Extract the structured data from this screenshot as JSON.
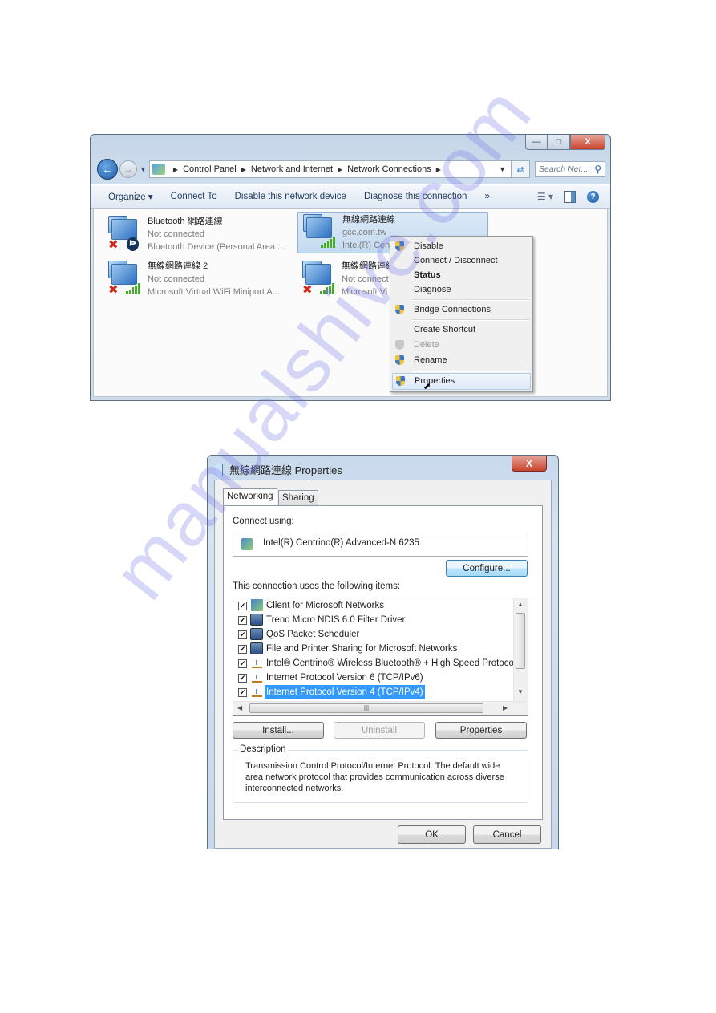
{
  "explorer": {
    "window_buttons": {
      "minimize": "—",
      "maximize": "□",
      "close": "X"
    },
    "breadcrumb": [
      "Control Panel",
      "Network and Internet",
      "Network Connections"
    ],
    "search_placeholder": "Search Net...",
    "toolbar": {
      "organize": "Organize ▾",
      "connect_to": "Connect To",
      "disable_device": "Disable this network device",
      "diagnose": "Diagnose this connection",
      "more": "»"
    },
    "connections": [
      {
        "name": "Bluetooth 網路連線",
        "status": "Not connected",
        "device": "Bluetooth Device (Personal Area ...",
        "icon": "bluetooth-disconnected",
        "selected": false
      },
      {
        "name": "無線網路連線",
        "status": "gcc.com.tw",
        "device": "Intel(R) Cent",
        "icon": "wireless-connected",
        "selected": true
      },
      {
        "name": "無線網路連線 2",
        "status": "Not connected",
        "device": "Microsoft Virtual WiFi Miniport A...",
        "icon": "wireless-disconnected",
        "selected": false
      },
      {
        "name": "無線網路連線",
        "status": "Not connect",
        "device": "Microsoft Vi",
        "icon": "wireless-disconnected",
        "selected": false
      }
    ],
    "context_menu": [
      {
        "label": "Disable",
        "shield": true
      },
      {
        "label": "Connect / Disconnect",
        "shield": false
      },
      {
        "label": "Status",
        "shield": false,
        "bold": true
      },
      {
        "label": "Diagnose",
        "shield": false
      },
      {
        "label": "Bridge Connections",
        "shield": true
      },
      {
        "label": "Create Shortcut",
        "shield": false
      },
      {
        "label": "Delete",
        "shield": true,
        "disabled": true
      },
      {
        "label": "Rename",
        "shield": true
      },
      {
        "label": "Properties",
        "shield": true,
        "hovered": true
      }
    ]
  },
  "dialog": {
    "title": "無線網路連線 Properties",
    "close": "X",
    "tabs": [
      "Networking",
      "Sharing"
    ],
    "active_tab": "Networking",
    "connect_using_label": "Connect using:",
    "adapter": "Intel(R) Centrino(R) Advanced-N 6235",
    "configure_button": "Configure...",
    "items_label": "This connection uses the following items:",
    "items": [
      {
        "label": "Client for Microsoft Networks",
        "checked": true,
        "icon": "network-client"
      },
      {
        "label": "Trend Micro NDIS 6.0 Filter Driver",
        "checked": true,
        "icon": "computer-service"
      },
      {
        "label": "QoS Packet Scheduler",
        "checked": true,
        "icon": "computer-service"
      },
      {
        "label": "File and Printer Sharing for Microsoft Networks",
        "checked": true,
        "icon": "computer-service"
      },
      {
        "label": "Intel® Centrino® Wireless Bluetooth® + High Speed Protocol",
        "checked": true,
        "icon": "protocol"
      },
      {
        "label": "Internet Protocol Version 6 (TCP/IPv6)",
        "checked": true,
        "icon": "protocol"
      },
      {
        "label": "Internet Protocol Version 4 (TCP/IPv4)",
        "checked": true,
        "icon": "protocol",
        "selected": true
      }
    ],
    "buttons": {
      "install": "Install...",
      "uninstall": "Uninstall",
      "properties": "Properties",
      "ok": "OK",
      "cancel": "Cancel"
    },
    "description_label": "Description",
    "description": "Transmission Control Protocol/Internet Protocol. The default wide area network protocol that provides communication across diverse interconnected networks."
  },
  "watermark": "manualshive.com",
  "colors": {
    "selection": "#3399ff",
    "close_button": "#c8432f",
    "hover_item": "#dde9f7"
  }
}
